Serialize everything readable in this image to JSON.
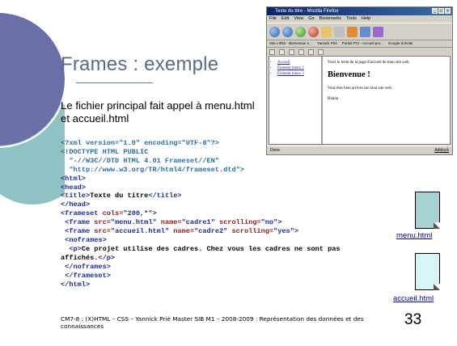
{
  "slide": {
    "title": "Frames : exemple",
    "intro": "Le fichier principal fait appel à menu.html et accueil.html",
    "footer": "CM7-8 : (X)HTML – CSS – Yannick Prié Master SIB M1 – 2008-2009 : Représentation des données et des connaissances",
    "page_number": "33"
  },
  "code_lines": {
    "l1": "<?xml version=\"1.0\" encoding=\"UTF-8\"?>",
    "l2": "<!DOCTYPE HTML PUBLIC",
    "l3": "  \"-//W3C//DTD HTML 4.01 Frameset//EN\"",
    "l4": "  \"http://www.w3.org/TR/html4/frameset.dtd\">",
    "l5_open": "<html>",
    "l6_open": "<head>",
    "l7_open": "<title>",
    "l7_text": "Texte du titre",
    "l7_close": "</title>",
    "l8_close": "</head>",
    "l9_tag": "<frameset",
    "l9_attr": " cols=",
    "l9_val": "\"200,*\"",
    "l9_end": ">",
    "l10_tag": " <frame",
    "l10_a1": " src=",
    "l10_v1": "\"menu.html\"",
    "l10_a2": " name=",
    "l10_v2": "\"cadre1\"",
    "l10_a3": " scrolling=",
    "l10_v3": "\"no\"",
    "l10_end": ">",
    "l11_tag": " <frame",
    "l11_a1": " src=",
    "l11_v1": "\"accueil.html\"",
    "l11_a2": " name=",
    "l11_v2": "\"cadre2\"",
    "l11_a3": " scrolling=",
    "l11_v3": "\"yes\"",
    "l11_end": ">",
    "l12_open": " <noframes>",
    "l13_open": "  <p>",
    "l13_text": "Ce projet utilise des cadres. Chez vous les cadres ne sont pas affichés.",
    "l13_close": "</p>",
    "l14_close": " </noframes>",
    "l15_close": " </frameset>",
    "l16_close": "</html>"
  },
  "browser": {
    "window_title": "Texte du titre - Mozilla Firefox",
    "menu_items": [
      "File",
      "Edit",
      "View",
      "Go",
      "Bookmarks",
      "Tools",
      "Help"
    ],
    "bookmarks": [
      "Site LIRIS - Bienvenue s...",
      "Yannick Prié",
      "Portail PCI - Accueil por...",
      "Google Scholar"
    ],
    "menu_links": [
      "Accueil",
      "Élément menu 2",
      "Élément menu 3"
    ],
    "page_intro": "Voici le texte de la page d'accueil de mon site web.",
    "heading": "Bienvenue !",
    "welcome_text": "Vous êtes bien arrivés sur mon site web.",
    "blabla": "Blabla",
    "status": "Done",
    "status_right": "Adblock"
  },
  "files": {
    "menu_label": "menu.html",
    "accueil_label": "accueil.html"
  },
  "colors": {
    "title": "#5a6a8c",
    "decor_dark": "#6b6fa8",
    "decor_teal": "#7bb8b8",
    "menu_file": "#a8d3d3",
    "accueil_file": "#d8f6f6"
  }
}
